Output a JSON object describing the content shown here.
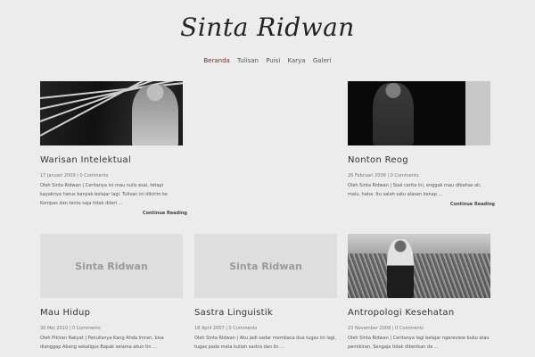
{
  "site": {
    "title": "Sinta Ridwan"
  },
  "nav": {
    "items": [
      {
        "label": "Beranda"
      },
      {
        "label": "Tulisan"
      },
      {
        "label": "Puisi"
      },
      {
        "label": "Karya"
      },
      {
        "label": "Galeri"
      }
    ]
  },
  "posts": [
    {
      "title": "Warisan Intelektual",
      "meta": "17 Januari 2009 | 0 Comments",
      "excerpt": "Oleh Sinta Ridwan | Ceritanya ini mau nulis esai, tetapi kayaknya harus banyak belajar lagi. Tulisan ini dikirim ke Kompas dan tentu saja tidak diteri ...",
      "more": "Continue Reading"
    },
    {
      "title": "Nonton Reog",
      "meta": "26 Februari 2008 | 0 Comments",
      "excerpt": "Oleh Sinta Ridwan |  Soal cerita ini, enggak mau dibahas ah, malu, haha. Itu salah satu alasan kenap ...",
      "more": "Continue Reading"
    },
    {
      "placeholder": "Sinta Ridwan",
      "title": "Mau Hidup",
      "meta": "30 Mei 2010 | 0 Comments",
      "excerpt": "Oleh Pikiran Rakyat | Penulisnya Kang Ahda Imran, bisa dianggap Abang sekaligus Bapak selama akun tin ..."
    },
    {
      "placeholder": "Sinta Ridwan",
      "title": "Sastra Linguistik",
      "meta": "18 April 2007 | 0 Comments",
      "excerpt": "Oleh Sinta Ridwan | Aku jadi sadar membaca dua tugas ini lagi, tugas pada mata kuliah sastra dan lin ..."
    },
    {
      "title": "Antropologi Kesehatan",
      "meta": "23 November 2008 | 0 Comments",
      "excerpt": "Oleh Sinta Ridwan | Ceritanya lagi belajar ngereview buku atau pemikiran. Sengaja tidak diberikan da ..."
    }
  ]
}
